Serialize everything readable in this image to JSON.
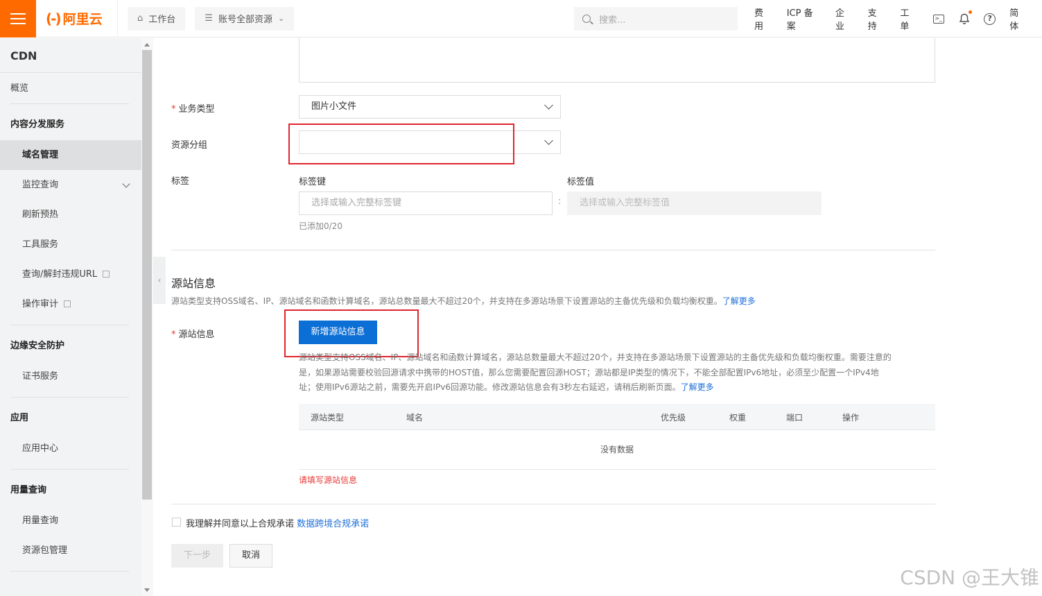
{
  "topbar": {
    "logo_text": "阿里云",
    "logo_mark": "(-)",
    "workbench": "工作台",
    "resource_scope": "账号全部资源",
    "search_placeholder": "搜索...",
    "links": [
      "费用",
      "ICP 备案",
      "企业",
      "支持",
      "工单"
    ],
    "language": "简体",
    "accent_color": "#ff6a00"
  },
  "sidebar": {
    "title": "CDN",
    "overview": "概览",
    "groups": [
      {
        "name": "内容分发服务",
        "items": [
          "域名管理",
          "监控查询",
          "刷新预热",
          "工具服务",
          "查询/解封违规URL",
          "操作审计"
        ]
      },
      {
        "name": "边缘安全防护",
        "items": [
          "证书服务"
        ]
      },
      {
        "name": "应用",
        "items": [
          "应用中心"
        ]
      },
      {
        "name": "用量查询",
        "items": [
          "用量查询",
          "资源包管理"
        ]
      }
    ],
    "active_item": "域名管理"
  },
  "form": {
    "business_type": {
      "label": "业务类型",
      "value": "图片小文件"
    },
    "resource_group": {
      "label": "资源分组",
      "value": ""
    },
    "tags": {
      "label": "标签",
      "key_label": "标签键",
      "key_placeholder": "选择或输入完整标签键",
      "separator": ":",
      "value_label": "标签值",
      "value_placeholder": "选择或输入完整标签值",
      "count_hint": "已添加0/20"
    }
  },
  "origin": {
    "section_title": "源站信息",
    "section_desc": "源站类型支持OSS域名、IP、源站域名和函数计算域名，源站总数量最大不超过20个，并支持在多源站场景下设置源站的主备优先级和负载均衡权重。",
    "learn_more": "了解更多",
    "field_label": "源站信息",
    "add_button": "新增源站信息",
    "detail_line1": "源站类型支持OSS域名、IP、源站域名和函数计算域名，源站总数量最大不超过20个，并支持在多源站场景下设置源站的主备优先级和负载均衡权重。需要注意的",
    "detail_line2": "是，如果源站需要校验回源请求中携带的HOST值，那么您需要配置回源HOST；源站都是IP类型的情况下，不能全部配置IPv6地址，必须至少配置一个IPv4地",
    "detail_line3": "址；使用IPv6源站之前，需要先开启IPv6回源功能。修改源站信息会有3秒左右延迟，请稍后刷新页面。",
    "table_columns": [
      "源站类型",
      "域名",
      "优先级",
      "权重",
      "端口",
      "操作"
    ],
    "empty_text": "没有数据",
    "error_text": "请填写源站信息"
  },
  "footer": {
    "agree_text": "我理解并同意以上合规承诺",
    "agree_link": "数据跨境合规承诺",
    "next_button": "下一步",
    "cancel_button": "取消"
  },
  "watermark": "CSDN @王大锥"
}
